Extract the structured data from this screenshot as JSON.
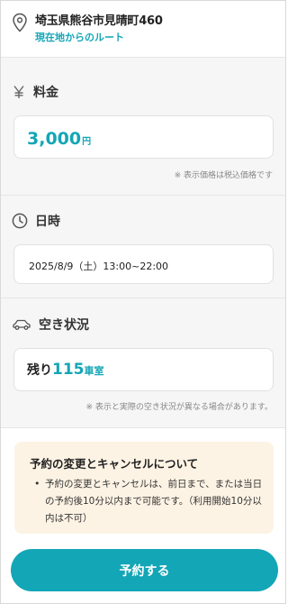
{
  "address": {
    "text": "埼玉県熊谷市見晴町460",
    "route_link": "現在地からのルート"
  },
  "price": {
    "heading": "料金",
    "value": "3,000",
    "unit": "円",
    "note": "※ 表示価格は税込価格です"
  },
  "datetime": {
    "heading": "日時",
    "value": "2025/8/9（土）13:00~22:00"
  },
  "vacancy": {
    "heading": "空き状況",
    "label": "残り",
    "count": "115",
    "unit": "車室",
    "note": "※ 表示と実際の空き状況が異なる場合があります。"
  },
  "notice": {
    "title": "予約の変更とキャンセルについて",
    "bullet": "•",
    "text": "予約の変更とキャンセルは、前日まで、または当日の予約後10分以内まで可能です。（利用開始10分以内は不可）"
  },
  "reserve_button": "予約する",
  "colors": {
    "accent": "#13a6b6",
    "section_bg": "#f6f6f6",
    "notice_bg": "#fdf3e4"
  },
  "icons": [
    "map-pin-icon",
    "yen-icon",
    "clock-icon",
    "car-icon"
  ]
}
